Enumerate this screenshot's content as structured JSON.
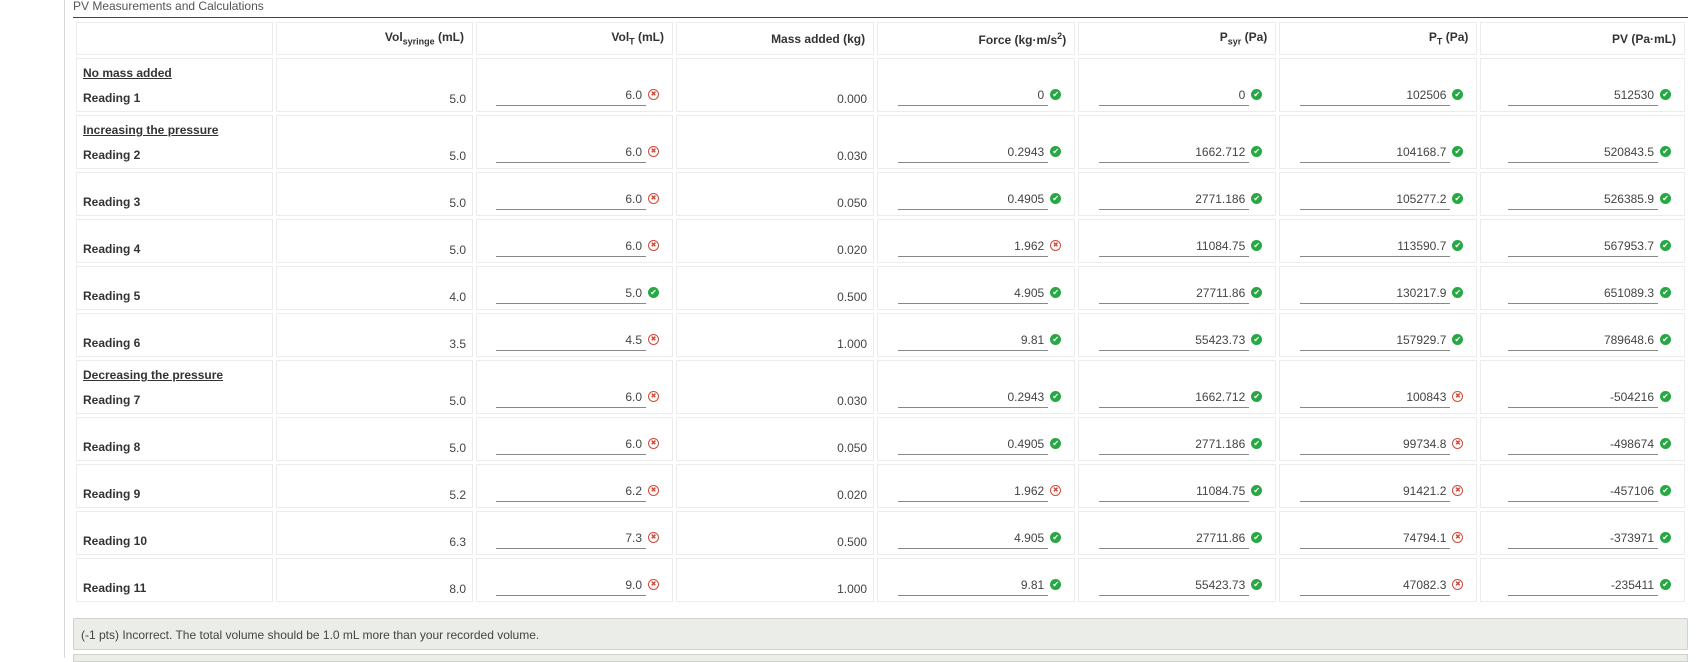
{
  "section_title": "PV Measurements and Calculations",
  "columns": [
    {
      "main": "Vol",
      "sub": "syringe",
      "sup": "",
      "unit": " (mL)"
    },
    {
      "main": "Vol",
      "sub": "T",
      "sup": "",
      "unit": " (mL)"
    },
    {
      "main": "Mass added (kg)",
      "sub": "",
      "sup": "",
      "unit": ""
    },
    {
      "main": "Force (kg·m/s",
      "sub": "",
      "sup": "2",
      "unit": ")"
    },
    {
      "main": "P",
      "sub": "syr",
      "sup": "",
      "unit": " (Pa)"
    },
    {
      "main": "P",
      "sub": "T",
      "sup": "",
      "unit": " (Pa)"
    },
    {
      "main": "PV (Pa·mL)",
      "sub": "",
      "sup": "",
      "unit": ""
    }
  ],
  "rows": [
    {
      "group": "No mass added",
      "label": "Reading 1",
      "vol_syringe": "5.0",
      "vol_t": "6.0",
      "vol_t_ok": false,
      "mass": "0.000",
      "force": "0",
      "force_ok": true,
      "p_syr": "0",
      "p_syr_ok": true,
      "p_t": "102506",
      "p_t_ok": true,
      "pv": "512530",
      "pv_ok": true
    },
    {
      "group": "Increasing the pressure",
      "label": "Reading 2",
      "vol_syringe": "5.0",
      "vol_t": "6.0",
      "vol_t_ok": false,
      "mass": "0.030",
      "force": "0.2943",
      "force_ok": true,
      "p_syr": "1662.712",
      "p_syr_ok": true,
      "p_t": "104168.7",
      "p_t_ok": true,
      "pv": "520843.5",
      "pv_ok": true
    },
    {
      "group": "",
      "label": "Reading 3",
      "vol_syringe": "5.0",
      "vol_t": "6.0",
      "vol_t_ok": false,
      "mass": "0.050",
      "force": "0.4905",
      "force_ok": true,
      "p_syr": "2771.186",
      "p_syr_ok": true,
      "p_t": "105277.2",
      "p_t_ok": true,
      "pv": "526385.9",
      "pv_ok": true
    },
    {
      "group": "",
      "label": "Reading 4",
      "vol_syringe": "5.0",
      "vol_t": "6.0",
      "vol_t_ok": false,
      "mass": "0.020",
      "force": "1.962",
      "force_ok": false,
      "p_syr": "11084.75",
      "p_syr_ok": true,
      "p_t": "113590.7",
      "p_t_ok": true,
      "pv": "567953.7",
      "pv_ok": true
    },
    {
      "group": "",
      "label": "Reading 5",
      "vol_syringe": "4.0",
      "vol_t": "5.0",
      "vol_t_ok": true,
      "mass": "0.500",
      "force": "4.905",
      "force_ok": true,
      "p_syr": "27711.86",
      "p_syr_ok": true,
      "p_t": "130217.9",
      "p_t_ok": true,
      "pv": "651089.3",
      "pv_ok": true
    },
    {
      "group": "",
      "label": "Reading 6",
      "vol_syringe": "3.5",
      "vol_t": "4.5",
      "vol_t_ok": false,
      "mass": "1.000",
      "force": "9.81",
      "force_ok": true,
      "p_syr": "55423.73",
      "p_syr_ok": true,
      "p_t": "157929.7",
      "p_t_ok": true,
      "pv": "789648.6",
      "pv_ok": true
    },
    {
      "group": "Decreasing the pressure",
      "label": "Reading 7",
      "vol_syringe": "5.0",
      "vol_t": "6.0",
      "vol_t_ok": false,
      "mass": "0.030",
      "force": "0.2943",
      "force_ok": true,
      "p_syr": "1662.712",
      "p_syr_ok": true,
      "p_t": "100843",
      "p_t_ok": false,
      "pv": "-504216",
      "pv_ok": true
    },
    {
      "group": "",
      "label": "Reading 8",
      "vol_syringe": "5.0",
      "vol_t": "6.0",
      "vol_t_ok": false,
      "mass": "0.050",
      "force": "0.4905",
      "force_ok": true,
      "p_syr": "2771.186",
      "p_syr_ok": true,
      "p_t": "99734.8",
      "p_t_ok": false,
      "pv": "-498674",
      "pv_ok": true
    },
    {
      "group": "",
      "label": "Reading 9",
      "vol_syringe": "5.2",
      "vol_t": "6.2",
      "vol_t_ok": false,
      "mass": "0.020",
      "force": "1.962",
      "force_ok": false,
      "p_syr": "11084.75",
      "p_syr_ok": true,
      "p_t": "91421.2",
      "p_t_ok": false,
      "pv": "-457106",
      "pv_ok": true
    },
    {
      "group": "",
      "label": "Reading 10",
      "vol_syringe": "6.3",
      "vol_t": "7.3",
      "vol_t_ok": false,
      "mass": "0.500",
      "force": "4.905",
      "force_ok": true,
      "p_syr": "27711.86",
      "p_syr_ok": true,
      "p_t": "74794.1",
      "p_t_ok": false,
      "pv": "-373971",
      "pv_ok": true
    },
    {
      "group": "",
      "label": "Reading 11",
      "vol_syringe": "8.0",
      "vol_t": "9.0",
      "vol_t_ok": false,
      "mass": "1.000",
      "force": "9.81",
      "force_ok": true,
      "p_syr": "55423.73",
      "p_syr_ok": true,
      "p_t": "47082.3",
      "p_t_ok": false,
      "pv": "-235411",
      "pv_ok": true
    }
  ],
  "icons": {
    "correct": "check-icon",
    "incorrect": "x-circle-icon"
  },
  "colors": {
    "correct": "#27a844",
    "incorrect": "#d04a3a",
    "feedback_bg": "#ebede8"
  },
  "feedback": "(-1 pts) Incorrect. The total volume should be 1.0 mL more than your recorded volume."
}
